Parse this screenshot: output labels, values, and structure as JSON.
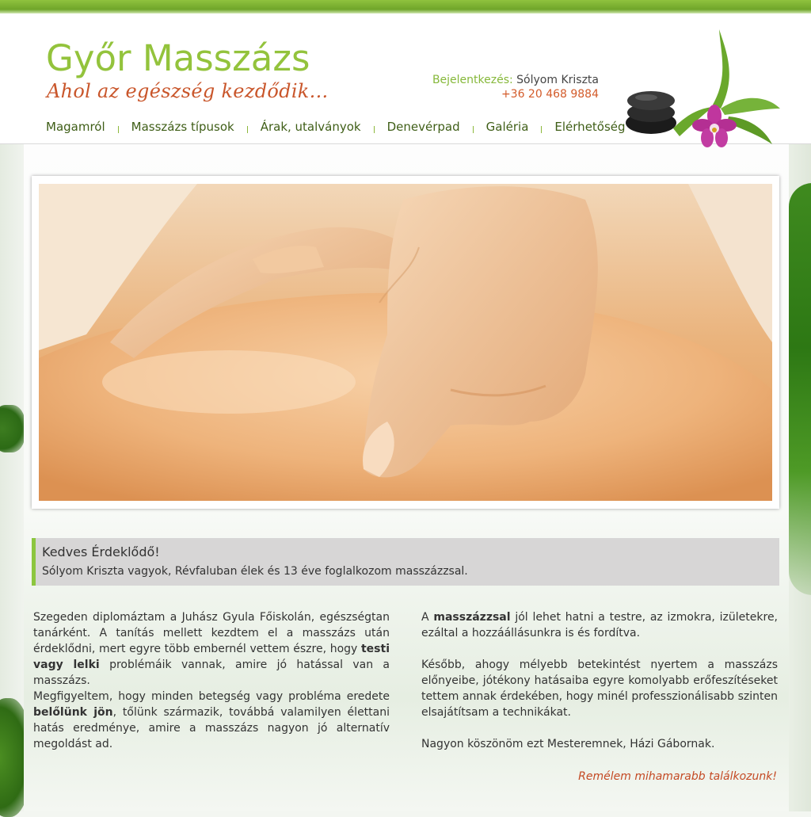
{
  "header": {
    "title": "Győr Masszázs",
    "subtitle": "Ahol az egészség kezdődik...",
    "login_label": "Bejelentkezés:",
    "login_name": "Sólyom Kriszta",
    "phone": "+36 20 468 9884"
  },
  "nav": {
    "items": [
      "Magamról",
      "Masszázs típusok",
      "Árak, utalványok",
      "Denevérpad",
      "Galéria",
      "Elérhetőség"
    ]
  },
  "greeting": {
    "title": "Kedves Érdeklődő!",
    "text": "Sólyom Kriszta vagyok, Révfaluban élek és 13 éve foglalkozom masszázzsal."
  },
  "left_column": {
    "p1_a": "Szegeden diplomáztam a Juhász Gyula Főiskolán, egészségtan tanárként. A tanítás mellett kezdtem el a masszázs után érdeklődni, mert egyre több embernél vettem észre, hogy ",
    "p1_bold": "testi vagy lelki",
    "p1_b": " problémáik vannak, amire jó hatással van a masszázs.",
    "p2_a": "Megfigyeltem, hogy minden betegség vagy probléma eredete ",
    "p2_bold": "belőlünk jön",
    "p2_b": ", tőlünk származik, továbbá valamilyen élettani hatás eredménye, amire a masszázs nagyon jó alternatív megoldást ad."
  },
  "right_column": {
    "p1_a": "A ",
    "p1_bold": "masszázzsal",
    "p1_b": " jól lehet hatni a testre, az izmokra, izületekre, ezáltal a hozzáállásunkra is és fordítva.",
    "p2": "Később, ahogy mélyebb betekintést nyertem a masszázs előnyeibe, jótékony hatásaiba egyre komolyabb erőfeszítéseket tettem annak érdekében, hogy minél professzionálisabb szinten elsajátítsam a technikákat.",
    "p3": "Nagyon köszönöm ezt Mesteremnek, Házi Gábornak."
  },
  "closing": "Remélem mihamarabb találkozunk!",
  "colors": {
    "brand_green": "#93c33c",
    "accent_orange": "#c9562b",
    "greeting_border": "#8cc63f"
  }
}
